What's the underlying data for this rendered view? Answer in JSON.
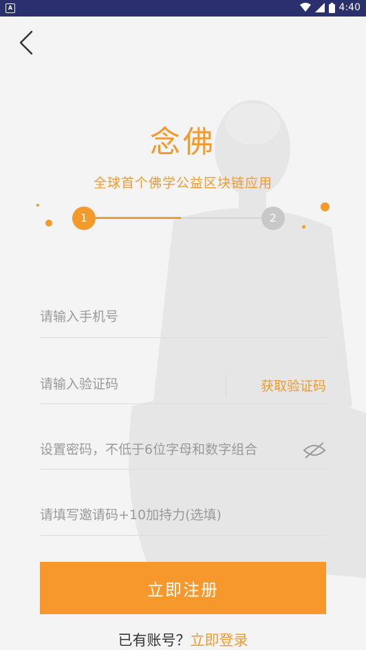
{
  "status_bar": {
    "time": "4:40"
  },
  "logo_text": "念佛",
  "tagline": "全球首个佛学公益区块链应用",
  "stepper": {
    "step1": "1",
    "step2": "2"
  },
  "form": {
    "phone_placeholder": "请输入手机号",
    "code_placeholder": "请输入验证码",
    "get_code_label": "获取验证码",
    "password_placeholder": "设置密码，不低于6位字母和数字组合",
    "invite_placeholder": "请填写邀请码+10加持力(选填)"
  },
  "register_button": "立即注册",
  "login_prompt": "已有账号？",
  "login_link": "立即登录",
  "colors": {
    "accent": "#f39a2d",
    "status_bar": "#2a2f6e"
  },
  "icons": [
    "back-arrow-icon",
    "eye-hidden-icon",
    "wifi-icon",
    "signal-icon",
    "battery-icon"
  ]
}
